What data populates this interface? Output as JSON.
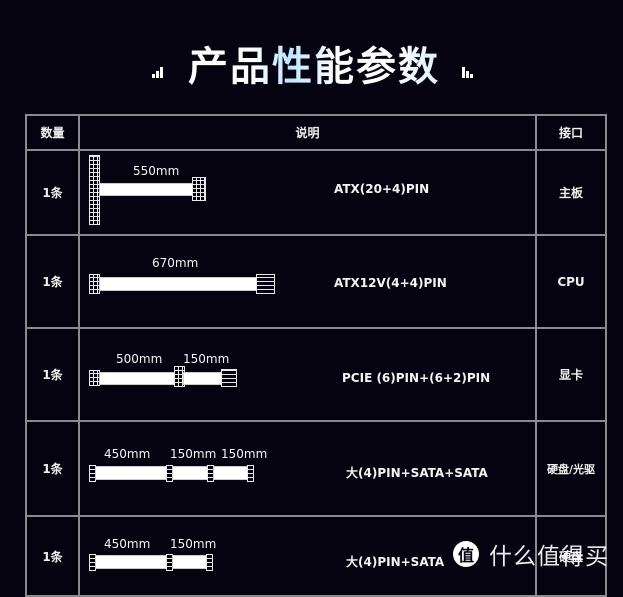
{
  "title": "产品性能参数",
  "table": {
    "headers": {
      "qty": "数量",
      "desc": "说明",
      "port": "接口"
    },
    "rows": [
      {
        "qty": "1条",
        "lengths": [
          "550mm"
        ],
        "pin": "ATX(20+4)PIN",
        "port": "主板"
      },
      {
        "qty": "1条",
        "lengths": [
          "670mm"
        ],
        "pin": "ATX12V(4+4)PIN",
        "port": "CPU"
      },
      {
        "qty": "1条",
        "lengths": [
          "500mm",
          "150mm"
        ],
        "pin": "PCIE (6)PIN+(6+2)PIN",
        "port": "显卡"
      },
      {
        "qty": "1条",
        "lengths": [
          "450mm",
          "150mm",
          "150mm"
        ],
        "pin": "大(4)PIN+SATA+SATA",
        "port": "硬盘/光驱"
      },
      {
        "qty": "1条",
        "lengths": [
          "450mm",
          "150mm"
        ],
        "pin": "大(4)PIN+SATA",
        "port": "硬盘"
      }
    ]
  },
  "watermark": {
    "logo": "值",
    "text": "什么值得买"
  }
}
